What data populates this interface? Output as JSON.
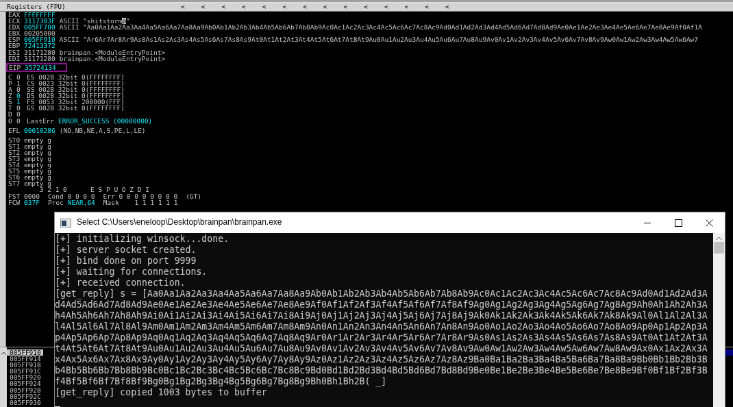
{
  "registers_pane": {
    "title": "Registers (FPU)",
    "column_arrows": [
      "<",
      "<",
      "<",
      "<",
      "<",
      "<",
      "<",
      "<",
      "<",
      "<",
      "<",
      "<",
      "<",
      "<"
    ],
    "registers": [
      {
        "name": "EAX",
        "value": "FFFFFFFF",
        "changed": true
      },
      {
        "name": "ECX",
        "value": "3117303F",
        "changed": true,
        "comment": "ASCII \"shitstorm",
        "marker": "@",
        "comment_end": "\""
      },
      {
        "name": "EDX",
        "value": "005FF700",
        "changed": true,
        "comment": "ASCII \"Aa0Aa1Aa2Aa3Aa4Aa5Aa6Aa7Aa8Aa9Ab0Ab1Ab2Ab3Ab4Ab5Ab6Ab7Ab8Ab9Ac0Ac1Ac2Ac3Ac4Ac5Ac6Ac7Ac8Ac9Ad0Ad1Ad2Ad3Ad4Ad5Ad6Ad7Ad8Ad9Ae0Ae1Ae2Ae3Ae4Ae5Ae6Ae7Ae8Ae9Af0Af1A"
      },
      {
        "name": "EBX",
        "value": "00205000",
        "changed": false
      },
      {
        "name": "ESP",
        "value": "005FF910",
        "changed": true,
        "comment": "ASCII \"Ar6Ar7Ar8Ar9As0As1As2As3As4As5As6As7As8As9At0At1At2At3At4At5At6At7At8At9Au0Au1Au2Au3Au4Au5Au6Au7Au8Au9Av0Av1Av2Av3Av4Av5Av6Av7Av8Av9Aw0Aw1Aw2Aw3Aw4Aw5Aw6Aw7"
      },
      {
        "name": "EBP",
        "value": "72413372",
        "changed": true
      },
      {
        "name": "ESI",
        "value": "31171280",
        "changed": false,
        "comment": "brainpan.<ModuleEntryPoint>"
      },
      {
        "name": "EDI",
        "value": "31171280",
        "changed": false,
        "comment": "brainpan.<ModuleEntryPoint>"
      }
    ],
    "instruction_pointer": {
      "name": "EIP",
      "value": "35724134",
      "changed": true,
      "highlighted": true
    },
    "flags": [
      {
        "kind": "segment",
        "flag": "C",
        "bit": "0",
        "changed": false,
        "detail": "ES 002B 32bit 0(FFFFFFFF)"
      },
      {
        "kind": "segment",
        "flag": "P",
        "bit": "1",
        "changed": false,
        "detail": "CS 0023 32bit 0(FFFFFFFF)"
      },
      {
        "kind": "segment",
        "flag": "A",
        "bit": "0",
        "changed": false,
        "detail": "SS 002B 32bit 0(FFFFFFFF)"
      },
      {
        "kind": "segment",
        "flag": "Z",
        "bit": "0",
        "changed": true,
        "detail": "DS 002B 32bit 0(FFFFFFFF)"
      },
      {
        "kind": "segment",
        "flag": "S",
        "bit": "1",
        "changed": true,
        "detail": "FS 0053 32bit 208000(FFF)"
      },
      {
        "kind": "segment",
        "flag": "T",
        "bit": "0",
        "changed": false,
        "detail": "GS 002B 32bit 0(FFFFFFFF)"
      },
      {
        "kind": "plain",
        "flag": "D",
        "bit": "0",
        "changed": false
      },
      {
        "kind": "lasterr",
        "flag": "O",
        "bit": "0",
        "changed": false,
        "detail": "LastErr",
        "value": "ERROR_SUCCESS (00000000)"
      }
    ],
    "efl": {
      "name": "EFL",
      "value": "00010286",
      "flags": "(NO,NB,NE,A,S,PE,L,LE)"
    },
    "fpu_stack": [
      "ST0 empty g",
      "ST1 empty g",
      "ST2 empty g",
      "ST3 empty g",
      "ST4 empty g",
      "ST5 empty g",
      "ST6 empty g",
      "ST7 empty g"
    ],
    "fpu_bits_header": "        3 2 1 0      E S P U O Z D I",
    "fst": {
      "name": "FST",
      "value": "0000",
      "cond": "Cond 0 0 0 0",
      "err": "Err 0 0 0 0 0 0 0 0",
      "result": "(GT)"
    },
    "fcw": {
      "name": "FCW",
      "value": "037F",
      "prec_label": "Prec",
      "prec": "NEAR,64",
      "mask": "Mask    1 1 1 1 1 1"
    }
  },
  "stack_pane": {
    "addresses": [
      {
        "address": "005FF910",
        "selected": true
      },
      {
        "address": "005FF914",
        "selected": false
      },
      {
        "address": "005FF918",
        "selected": false
      },
      {
        "address": "005FF91C",
        "selected": false
      },
      {
        "address": "005FF920",
        "selected": false
      },
      {
        "address": "005FF924",
        "selected": false
      },
      {
        "address": "005FF928",
        "selected": false
      },
      {
        "address": "005FF92C",
        "selected": false
      },
      {
        "address": "005FF930",
        "selected": false
      }
    ]
  },
  "console": {
    "title": "Select C:\\Users\\eneloop\\Desktop\\brainpan\\brainpan.exe",
    "lines": [
      "[+] initializing winsock...done.",
      "[+] server socket created.",
      "[+] bind done on port 9999",
      "[+] waiting for connections.",
      "[+] received connection.",
      "[get_reply] s = [Aa0Aa1Aa2Aa3Aa4Aa5Aa6Aa7Aa8Aa9Ab0Ab1Ab2Ab3Ab4Ab5Ab6Ab7Ab8Ab9Ac0Ac1Ac2Ac3Ac4Ac5Ac6Ac7Ac8Ac9Ad0Ad1Ad2Ad3A",
      "d4Ad5Ad6Ad7Ad8Ad9Ae0Ae1Ae2Ae3Ae4Ae5Ae6Ae7Ae8Ae9Af0Af1Af2Af3Af4Af5Af6Af7Af8Af9Ag0Ag1Ag2Ag3Ag4Ag5Ag6Ag7Ag8Ag9Ah0Ah1Ah2Ah3A",
      "h4Ah5Ah6Ah7Ah8Ah9Ai0Ai1Ai2Ai3Ai4Ai5Ai6Ai7Ai8Ai9Aj0Aj1Aj2Aj3Aj4Aj5Aj6Aj7Aj8Aj9Ak0Ak1Ak2Ak3Ak4Ak5Ak6Ak7Ak8Ak9Al0Al1Al2Al3A",
      "l4Al5Al6Al7Al8Al9Am0Am1Am2Am3Am4Am5Am6Am7Am8Am9An0An1An2An3An4An5An6An7An8An9Ao0Ao1Ao2Ao3Ao4Ao5Ao6Ao7Ao8Ao9Ap0Ap1Ap2Ap3A",
      "p4Ap5Ap6Ap7Ap8Ap9Aq0Aq1Aq2Aq3Aq4Aq5Aq6Aq7Aq8Aq9Ar0Ar1Ar2Ar3Ar4Ar5Ar6Ar7Ar8Ar9As0As1As2As3As4As5As6As7As8As9At0At1At2At3A",
      "t4At5At6At7At8At9Au0Au1Au2Au3Au4Au5Au6Au7Au8Au9Av0Av1Av2Av3Av4Av5Av6Av7Av8Av9Aw0Aw1Aw2Aw3Aw4Aw5Aw6Aw7Aw8Aw9Ax0Ax1Ax2Ax3A",
      "x4Ax5Ax6Ax7Ax8Ax9Ay0Ay1Ay2Ay3Ay4Ay5Ay6Ay7Ay8Ay9Az0Az1Az2Az3Az4Az5Az6Az7Az8Az9Ba0Ba1Ba2Ba3Ba4Ba5Ba6Ba7Ba8Ba9Bb0Bb1Bb2Bb3B",
      "b4Bb5Bb6Bb7Bb8Bb9Bc0Bc1Bc2Bc3Bc4Bc5Bc6Bc7Bc8Bc9Bd0Bd1Bd2Bd3Bd4Bd5Bd6Bd7Bd8Bd9Be0Be1Be2Be3Be4Be5Be6Be7Be8Be9Bf0Bf1Bf2Bf3B",
      "f4Bf5Bf6Bf7Bf8Bf9Bg0Bg1Bg2Bg3Bg4Bg5Bg6Bg7Bg8Bg9Bh0Bh1Bh2B( _]",
      "[get_reply] copied 1003 bytes to buffer"
    ]
  }
}
